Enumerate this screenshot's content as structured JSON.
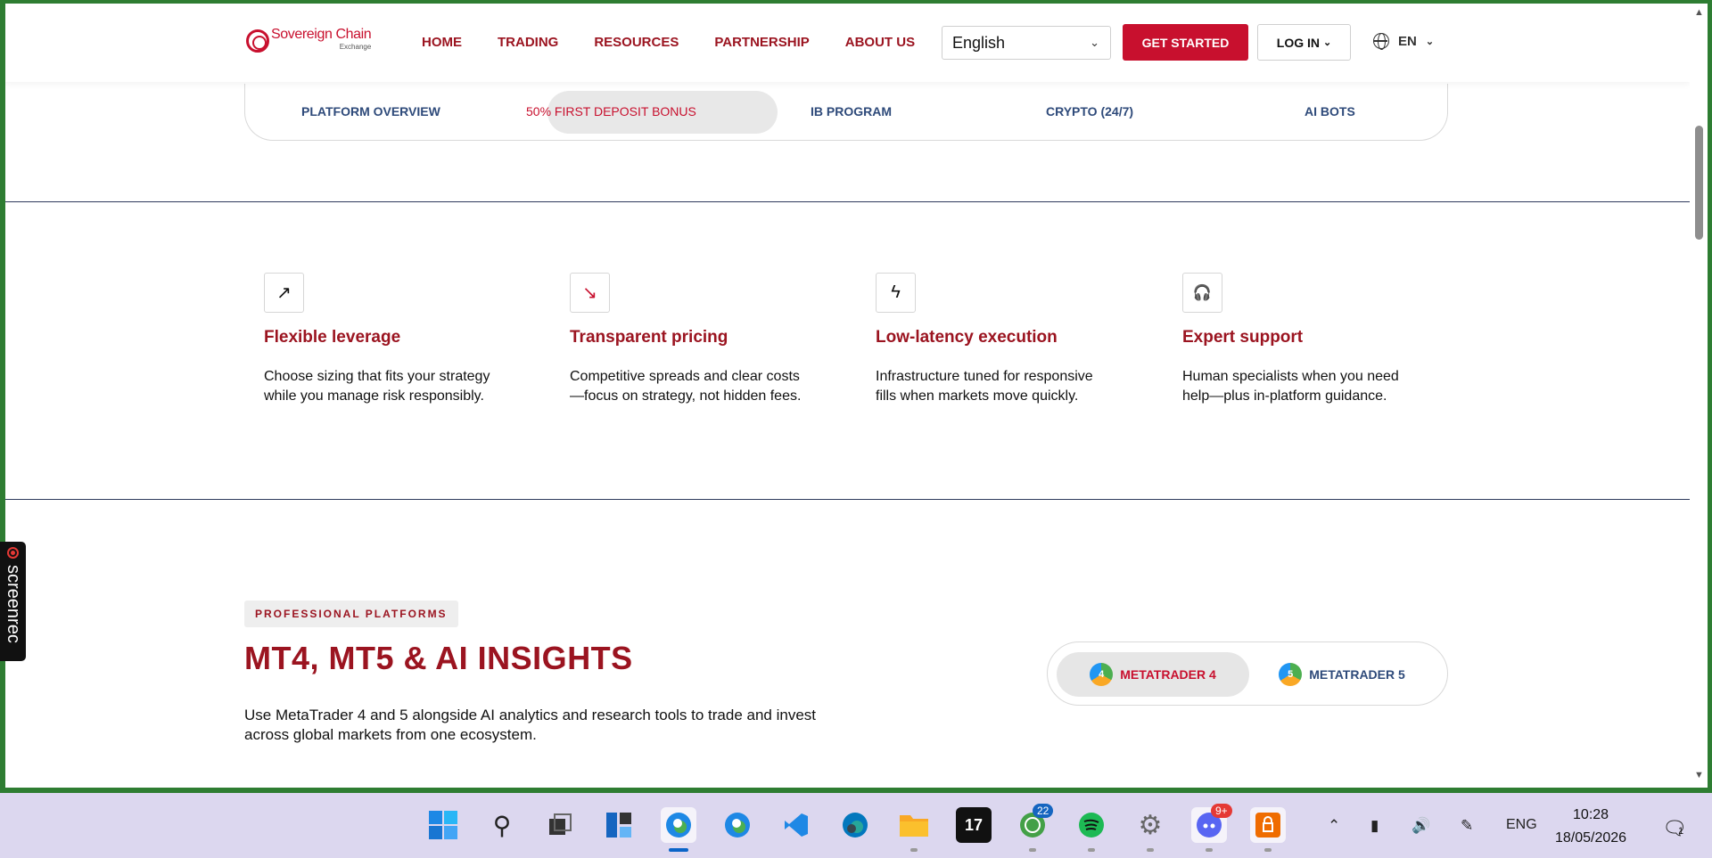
{
  "header": {
    "logo_text": "Sovereign Chain",
    "logo_sub": "Exchange",
    "nav": [
      "HOME",
      "TRADING",
      "RESOURCES",
      "PARTNERSHIP",
      "ABOUT US"
    ],
    "language_value": "English",
    "get_started": "GET STARTED",
    "login": "LOG IN",
    "lang_code": "EN"
  },
  "subtabs": [
    "PLATFORM OVERVIEW",
    "50% FIRST DEPOSIT BONUS",
    "IB PROGRAM",
    "CRYPTO (24/7)",
    "AI BOTS"
  ],
  "features": [
    {
      "icon": "arrow-up-right-icon",
      "glyph": "↗",
      "title": "Flexible leverage",
      "desc": "Choose sizing that fits your strategy while you manage risk responsibly."
    },
    {
      "icon": "arrow-down-right-icon",
      "glyph": "↘",
      "title": "Transparent pricing",
      "desc": "Competitive spreads and clear costs—focus on strategy, not hidden fees."
    },
    {
      "icon": "lightning-icon",
      "glyph": "ϟ",
      "title": "Low-latency execution",
      "desc": "Infrastructure tuned for responsive fills when markets move quickly."
    },
    {
      "icon": "headset-icon",
      "glyph": "🎧",
      "title": "Expert support",
      "desc": "Human specialists when you need help—plus in-platform guidance."
    }
  ],
  "platforms": {
    "tag": "PROFESSIONAL PLATFORMS",
    "title": "MT4, MT5 & AI INSIGHTS",
    "intro": "Use MetaTrader 4 and 5 alongside AI analytics and research tools to trade and invest across global markets from one ecosystem.",
    "mt4": "METATRADER 4",
    "mt4_num": "4",
    "mt5": "METATRADER 5",
    "mt5_num": "5"
  },
  "screenrec": "screenrec",
  "taskbar": {
    "whatsapp_badge": "22",
    "discord_badge": "9+",
    "lang": "ENG",
    "time": "10:28",
    "date": "18/05/2026",
    "notif_count": "1"
  },
  "colors": {
    "brand_red": "#c8102e",
    "dark_red": "#9b1420",
    "navy": "#2e4a7a"
  }
}
